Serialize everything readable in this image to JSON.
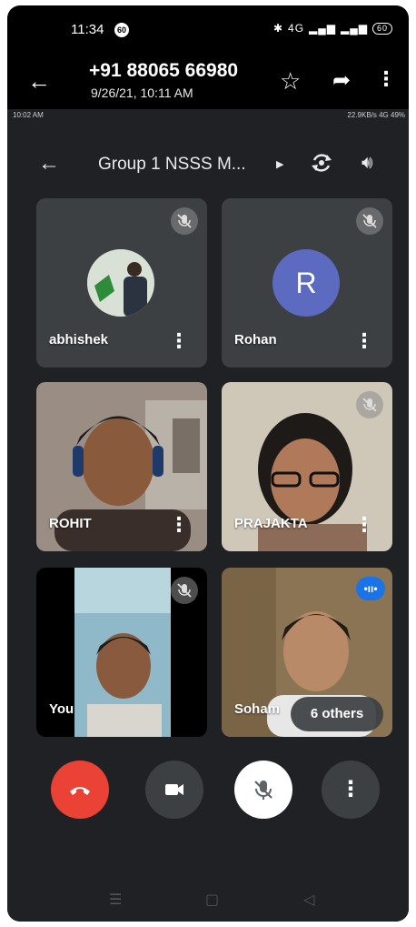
{
  "status_bar": {
    "time": "11:34",
    "badge": "60",
    "signal_text": "4G",
    "battery": "60"
  },
  "viewer": {
    "contact": "+91 88065 66980",
    "date": "9/26/21, 10:11 AM"
  },
  "screenshot": {
    "status_left": "10:02 AM",
    "status_right": "22.9KB/s  4G  49%",
    "meeting_title": "Group 1 NSSS M...",
    "participants": [
      {
        "name": "abhishek",
        "type": "photo-avatar",
        "muted": true
      },
      {
        "name": "Rohan",
        "type": "letter-avatar",
        "initial": "R",
        "muted": true
      },
      {
        "name": "ROHIT",
        "type": "video",
        "muted": false
      },
      {
        "name": "PRAJAKTA",
        "type": "video",
        "muted": true
      },
      {
        "name": "You",
        "type": "video",
        "muted": true
      },
      {
        "name": "Soham",
        "type": "video",
        "speaking": true
      }
    ],
    "others_label": "6 others"
  },
  "colors": {
    "end_call": "#ea4335",
    "avatar_bg": "#5c6bc0",
    "tile_bg": "#3c4043",
    "speaker_indicator": "#1a73e8"
  }
}
